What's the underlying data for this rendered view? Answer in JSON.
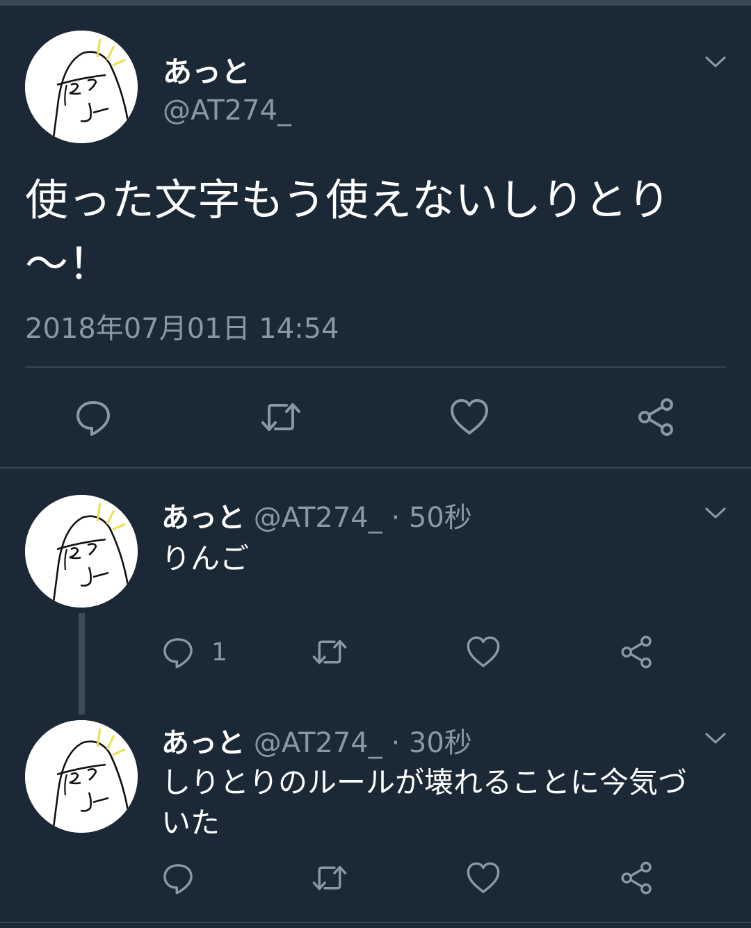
{
  "main_tweet": {
    "display_name": "あっと",
    "handle": "@AT274_",
    "text_line1": "使った文字もう使えないしりとり",
    "text_line2": "〜！",
    "timestamp": "2018年07月01日 14:54"
  },
  "reply1": {
    "display_name": "あっと",
    "meta": "@AT274_ · 50秒",
    "text": "りんご",
    "reply_count": "1"
  },
  "reply2": {
    "display_name": "あっと",
    "meta": "@AT274_ · 30秒",
    "text_line1": "しりとりのルールが壊れることに今気づ",
    "text_line2": "いた"
  },
  "colors": {
    "background": "#1b2836",
    "muted_text": "#8899a6",
    "divider": "#38444d",
    "avatar_sparkle": "#e8e04a"
  },
  "icons": [
    "avatar-face",
    "chevron-down-icon",
    "reply-icon",
    "retweet-icon",
    "like-icon",
    "share-icon"
  ]
}
